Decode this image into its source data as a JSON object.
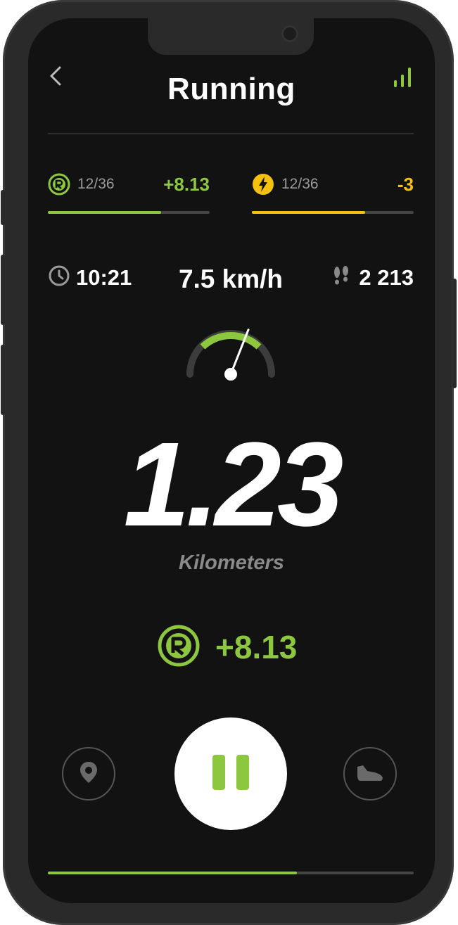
{
  "header": {
    "title": "Running"
  },
  "stats": {
    "rewards": {
      "count": "12/36",
      "delta": "+8.13",
      "progress": 0.7,
      "color": "#8dc63f"
    },
    "energy": {
      "count": "12/36",
      "delta": "-3",
      "progress": 0.7,
      "color": "#f4c10f"
    }
  },
  "metrics": {
    "time": "10:21",
    "speed": "7.5 km/h",
    "steps": "2 213"
  },
  "gauge": {
    "level": 0.62
  },
  "distance": {
    "value": "1.23",
    "unit": "Kilometers"
  },
  "reward": {
    "value": "+8.13"
  },
  "progress": {
    "fraction": 0.68
  },
  "icons": {
    "back": "chevron-left-icon",
    "signal": "signal-icon",
    "rewards": "r-coin-icon",
    "energy": "lightning-icon",
    "time": "clock-icon",
    "steps": "footprints-icon",
    "location": "location-pin-icon",
    "pause": "pause-icon",
    "shoe": "shoe-icon"
  },
  "colors": {
    "accent": "#8dc63f",
    "energy": "#f4c10f",
    "background": "#121212"
  }
}
